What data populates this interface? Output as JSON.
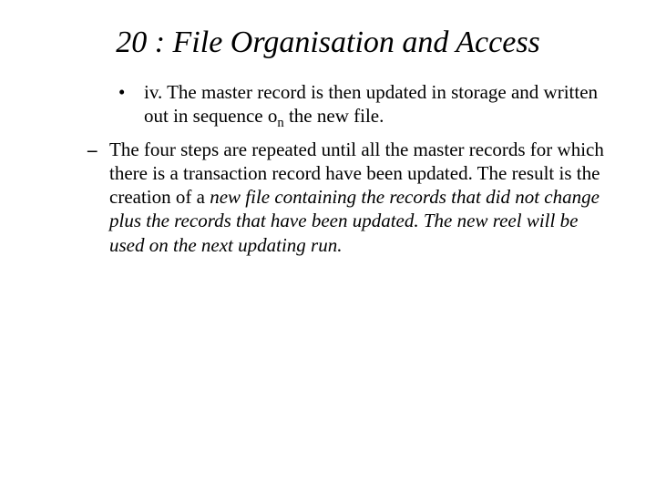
{
  "title": "20 : File Organisation and Access",
  "item1_a": "iv. The master record is then updated in storage and written out in sequence o",
  "item1_sub": "n",
  "item1_b": " the new file.",
  "item2_a": "The four steps are repeated until all the master records for which there is a transaction record have been updated. The result is the creation of a ",
  "item2_i": "new file containing the records that did not change plus the records that have been updated. The new reel will be used on the next updating run."
}
